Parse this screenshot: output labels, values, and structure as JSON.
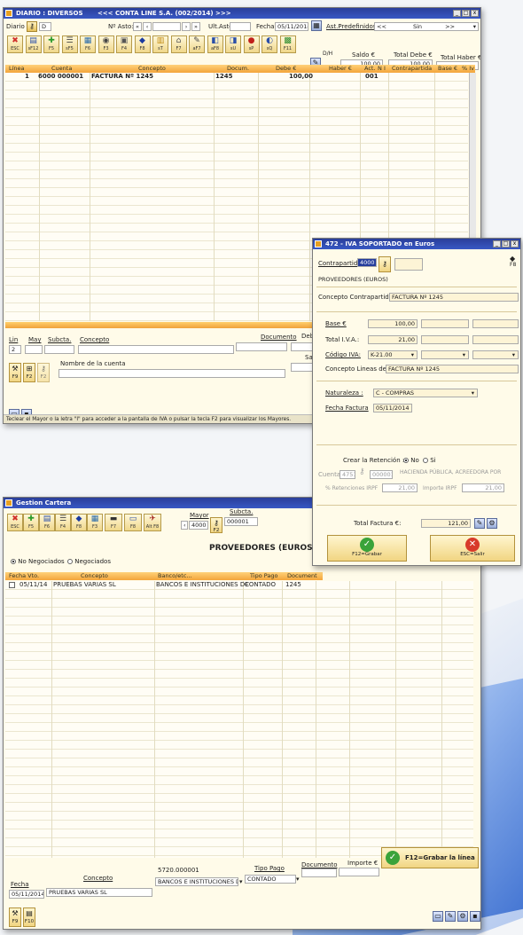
{
  "diario": {
    "title": "DIARIO : DIVERSOS",
    "company": "<<< CONTA LINE S.A. (002/2014) >>>",
    "labels": {
      "diario": "Diario",
      "n_asto": "Nº Asto:",
      "ult_asto": "Ult.Asto",
      "fecha": "Fecha:",
      "ast_pred": "Ast.Predefinidos:",
      "saldo": "Saldo €",
      "total_debe": "Total Debe €",
      "total_haber": "Total Haber €",
      "dh": "D/H"
    },
    "values": {
      "diario": "D",
      "fecha": "05/11/2014",
      "pred_prev": "<<",
      "pred_val": "Sin",
      "pred_next": ">>",
      "saldo": "100,00",
      "total_debe": "100,00",
      "total_haber": ""
    },
    "toolbar": [
      "ESC",
      "sF12",
      "F5",
      "sF5",
      "F6",
      "F3",
      "F4",
      "F8",
      "sT",
      "F7",
      "aF7",
      "aF8",
      "sU",
      "sP",
      "sQ",
      "F11"
    ],
    "columns": [
      "Línea",
      "Cuenta",
      "Concepto",
      "Docum.",
      "Debe €",
      "Haber €",
      "Act.",
      "N",
      "I",
      "Contrapartida",
      "Base €",
      "% Iv"
    ],
    "rows": [
      {
        "linea": "1",
        "cuenta": "6000 000001",
        "concepto": "FACTURA Nº 1245",
        "docum": "1245",
        "debe": "100,00",
        "haber": "",
        "act": "001"
      }
    ],
    "edit_labels": {
      "lin": "Lin",
      "may": "May",
      "subcta": "Subcta.",
      "concepto": "Concepto",
      "documento": "Documento",
      "debe": "Debe",
      "saldo": "Sal",
      "nombre_cuenta": "Nombre de la cuenta"
    },
    "edit_values": {
      "lin": "2"
    },
    "bottom_buttons": [
      "F9",
      "F2",
      "F2"
    ],
    "status": "Teclear el Mayor o la letra \"I\" para acceder a la pantalla de IVA o pulsar la tecla F2 para visualizar los Mayores."
  },
  "iva": {
    "title": "472 - IVA SOPORTADO en Euros",
    "contrapartida_label": "Contrapartida :",
    "contrapartida_value": "4000",
    "f8": "F8",
    "proveedor": "PROVEEDORES (EUROS)",
    "concepto_contra_label": "Concepto Contrapartida :",
    "concepto_contra_value": "FACTURA Nº 1245",
    "base_label": "Base €",
    "base_value": "100,00",
    "total_iva_label": "Total I.V.A.:",
    "total_iva_value": "21,00",
    "codigo_iva_label": "Código IVA:",
    "codigo_iva_value": "K-21.00",
    "concepto_lineas_label": "Concepto Lineas de Iva :",
    "concepto_lineas_value": "FACTURA Nº 1245",
    "naturaleza_label": "Naturaleza :",
    "naturaleza_value": "C - COMPRAS",
    "fecha_factura_label": "Fecha Factura",
    "fecha_factura_value": "05/11/2014",
    "retencion_label": "Crear la Retención :",
    "retencion_no": "No",
    "retencion_si": "Si",
    "cuenta_label": "Cuenta",
    "cuenta_value": "4751",
    "cuenta_sub": "000001",
    "cuenta_name": "HACIENDA PÚBLICA, ACREEDORA POR",
    "ret_pct_label": "% Retenciones IRPF",
    "ret_pct_value": "21,00",
    "importe_irpf_label": "Importe IRPF",
    "importe_irpf_value": "21,00",
    "total_factura_label": "Total Factura €:",
    "total_factura_value": "121,00",
    "grabar": "F12=Grabar",
    "salir": "ESC=Salir"
  },
  "cartera": {
    "title": "Gestion Cartera",
    "toolbar": [
      "ESC",
      "F5",
      "F6",
      "F4",
      "F8",
      "F3",
      "F7",
      "F8",
      "Alt F8"
    ],
    "mayor_label": "Mayor",
    "subcta_label": "Subcta.",
    "mayor_value": "4000",
    "subcta_value": "000001",
    "f2": "F2",
    "proveedor": "PROVEEDORES (EUROS)",
    "no_negociados": "No Negociados",
    "negociados": "Negociados",
    "columns": [
      "Fecha Vto.",
      "Concepto",
      "Banco/etc...",
      "Tipo Pago",
      "Document"
    ],
    "rows": [
      {
        "fecha": "05/11/14",
        "concepto": "PRUEBAS VARIAS SL",
        "banco": "BANCOS E INSTITUCIONES DE",
        "tipo": "CONTADO",
        "doc": "1245"
      }
    ],
    "edit_labels": {
      "fecha": "Fecha",
      "concepto": "Concepto",
      "banco": "5720.000001",
      "tipo_pago": "Tipo Pago",
      "documento": "Documento",
      "importe": "Importe €"
    },
    "edit_values": {
      "fecha": "05/11/2014",
      "concepto": "PRUEBAS VARIAS SL",
      "banco": "BANCOS E INSTITUCIONES D",
      "tipo_pago": "CONTADO"
    },
    "grabar_linea": "F12=Grabar la línea",
    "bottom_buttons": [
      "F9",
      "F10"
    ]
  }
}
